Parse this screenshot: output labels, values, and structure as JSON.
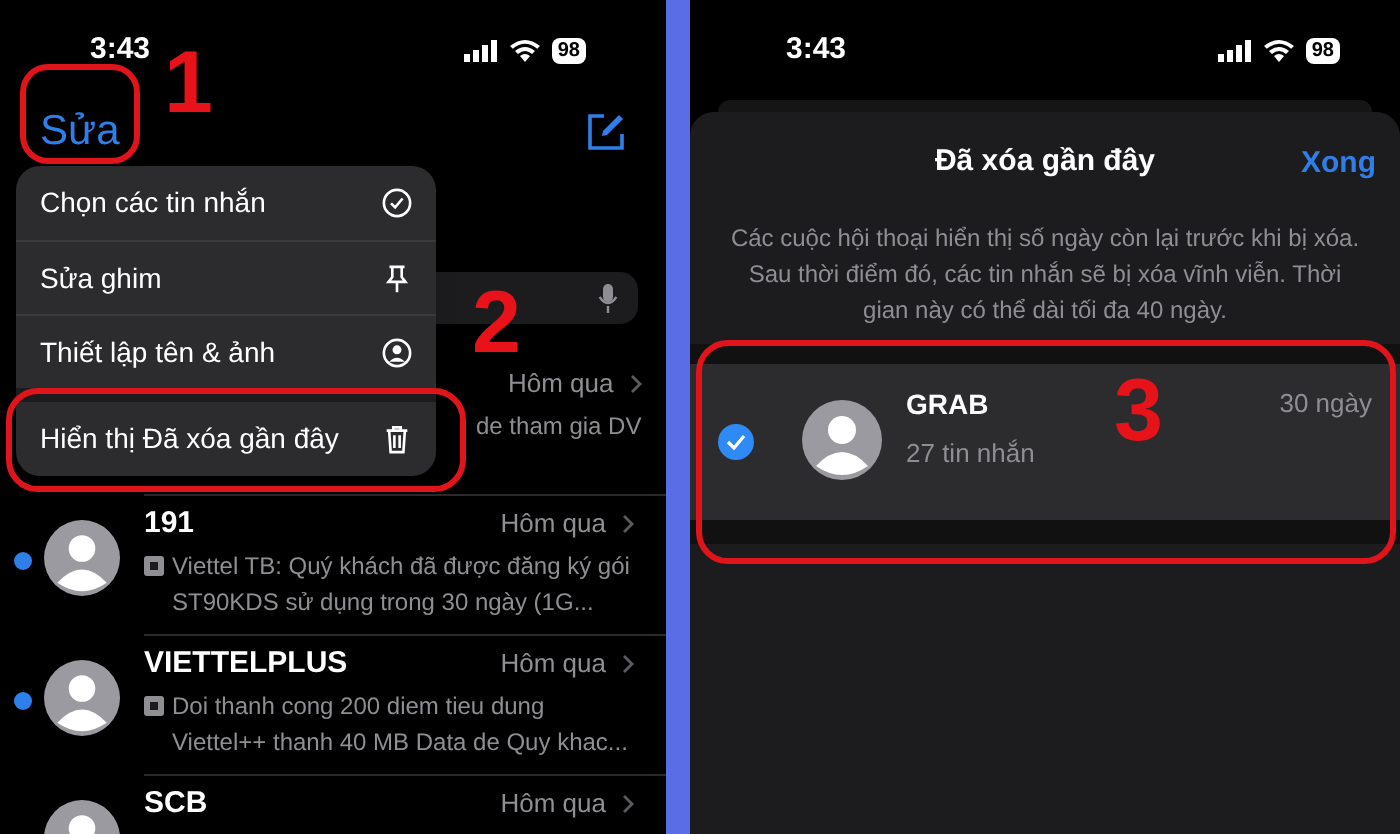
{
  "left_screen": {
    "status_bar": {
      "time": "3:43",
      "battery": "98"
    },
    "edit_button": "Sửa",
    "menu": [
      {
        "label": "Chọn các tin nhắn",
        "kind": "check"
      },
      {
        "label": "Sửa ghim",
        "kind": "pin"
      },
      {
        "label": "Thiết lập tên & ảnh",
        "kind": "person"
      },
      {
        "label": "Hiển thị Đã xóa gần đây",
        "kind": "trash"
      }
    ],
    "conversations": [
      {
        "time": "Hôm qua",
        "preview": "de tham gia DV",
        "unread": false
      },
      {
        "name": "191",
        "time": "Hôm qua",
        "preview": "Viettel TB: Quý khách đã được đăng ký gói ST90KDS sử dụng trong 30 ngày (1G...",
        "unread": true
      },
      {
        "name": "VIETTELPLUS",
        "time": "Hôm qua",
        "preview": "Doi thanh cong 200 diem tieu dung Viettel++ thanh 40 MB Data de Quy khac...",
        "unread": true
      },
      {
        "name": "SCB",
        "time": "Hôm qua",
        "unread": false
      }
    ]
  },
  "right_screen": {
    "status_bar": {
      "time": "3:43",
      "battery": "98"
    },
    "sheet": {
      "title": "Đã xóa gần đây",
      "done_button": "Xong",
      "description": "Các cuộc hội thoại hiển thị số ngày còn lại trước khi bị xóa. Sau thời điểm đó, các tin nhắn sẽ bị xóa vĩnh viễn. Thời gian này có thể dài tối đa 40 ngày.",
      "items": [
        {
          "name": "GRAB",
          "count": "27 tin nhắn",
          "days": "30 ngày",
          "selected": true
        }
      ]
    }
  },
  "annotations": [
    {
      "label": "1"
    },
    {
      "label": "2"
    },
    {
      "label": "3"
    }
  ]
}
